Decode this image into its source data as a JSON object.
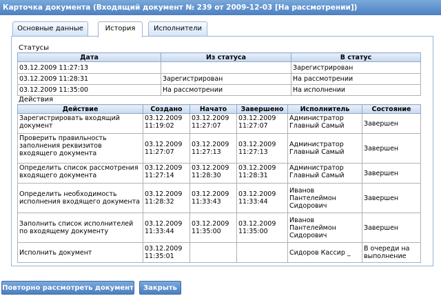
{
  "window": {
    "title": "Карточка документа (Входящий документ № 239 от 2009-12-03 [На рассмотрении])"
  },
  "tabs": [
    {
      "label": "Основные данные"
    },
    {
      "label": "История"
    },
    {
      "label": "Исполнители"
    }
  ],
  "statuses": {
    "label": "Статусы",
    "headers": [
      "Дата",
      "Из статуса",
      "В статус"
    ],
    "rows": [
      [
        "03.12.2009 11:27:13",
        "",
        "Зарегистрирован"
      ],
      [
        "03.12.2009 11:28:31",
        "Зарегистрирован",
        "На рассмотрении"
      ],
      [
        "03.12.2009 11:35:00",
        "На рассмотрении",
        "На исполнении"
      ]
    ]
  },
  "actions": {
    "label": "Действия",
    "headers": [
      "Действие",
      "Создано",
      "Начато",
      "Завершено",
      "Исполнитель",
      "Состояние"
    ],
    "rows": [
      [
        "Зарегистрировать входящий документ",
        "03.12.2009 11:19:02",
        "03.12.2009 11:27:07",
        "03.12.2009 11:27:07",
        "Администратор Главный Самый",
        "Завершен"
      ],
      [
        "Проверить правильность заполнения реквизитов входящего документа",
        "03.12.2009 11:27:07",
        "03.12.2009 11:27:13",
        "03.12.2009 11:27:13",
        "Администратор Главный Самый",
        "Завершен"
      ],
      [
        "Определить список рассмотрения входящего документа",
        "03.12.2009 11:27:14",
        "03.12.2009 11:28:30",
        "03.12.2009 11:28:31",
        "Администратор Главный Самый",
        "Завершен"
      ],
      [
        "Определить необходимость исполнения входящего документа",
        "03.12.2009 11:28:32",
        "03.12.2009 11:33:43",
        "03.12.2009 11:33:44",
        "Иванов Пантелеймон Сидорович",
        "Завершен"
      ],
      [
        "Заполнить список исполнителей по входящему документу",
        "03.12.2009 11:33:44",
        "03.12.2009 11:35:00",
        "03.12.2009 11:35:00",
        "Иванов Пантелеймон Сидорович",
        "Завершен"
      ],
      [
        "Исполнить документ",
        "03.12.2009 11:35:01",
        "",
        "",
        "Сидоров Кассир _",
        "В очереди на выполнение"
      ]
    ]
  },
  "buttons": {
    "review": "Повторно рассмотреть документ",
    "close": "Закрыть"
  }
}
